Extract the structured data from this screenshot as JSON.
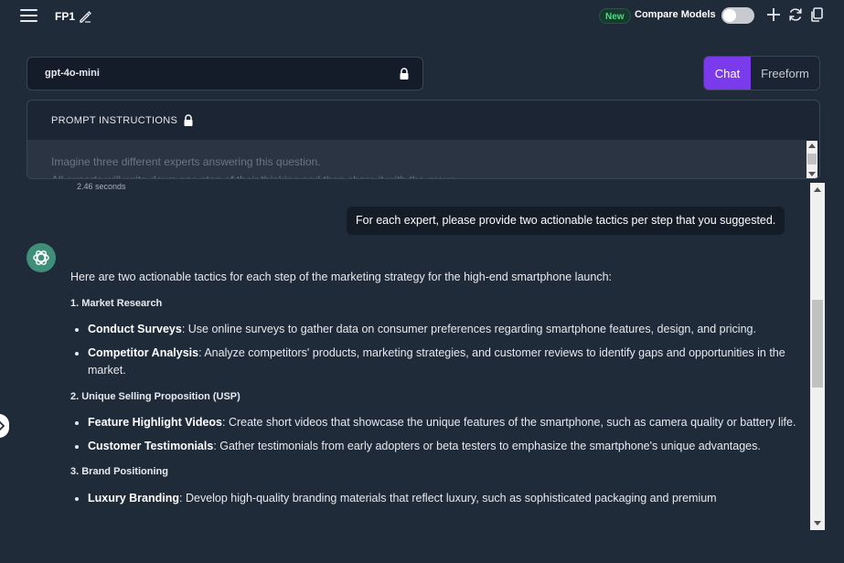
{
  "header": {
    "title": "FP1",
    "new_badge": "New",
    "compare_label": "Compare Models",
    "compare_enabled": false
  },
  "model": {
    "name": "gpt-4o-mini"
  },
  "mode": {
    "chat_label": "Chat",
    "freeform_label": "Freeform",
    "selected": "Chat"
  },
  "prompt": {
    "title": "PROMPT INSTRUCTIONS",
    "line1": "Imagine three different experts answering this question.",
    "line2": "All experts will write down one step of their thinking and then share it with the group."
  },
  "chat": {
    "timing": "2.46 seconds",
    "user_message": "For each expert, please provide two actionable tactics per step that you suggested.",
    "assistant": {
      "intro": "Here are two actionable tactics for each step of the marketing strategy for the high-end smartphone launch:",
      "sections": [
        {
          "title": "1. Market Research",
          "items": [
            {
              "bold": "Conduct Surveys",
              "text": ": Use online surveys to gather data on consumer preferences regarding smartphone features, design, and pricing."
            },
            {
              "bold": "Competitor Analysis",
              "text": ": Analyze competitors' products, marketing strategies, and customer reviews to identify gaps and opportunities in the market."
            }
          ]
        },
        {
          "title": "2. Unique Selling Proposition (USP)",
          "items": [
            {
              "bold": "Feature Highlight Videos",
              "text": ": Create short videos that showcase the unique features of the smartphone, such as camera quality or battery life."
            },
            {
              "bold": "Customer Testimonials",
              "text": ": Gather testimonials from early adopters or beta testers to emphasize the smartphone's unique advantages."
            }
          ]
        },
        {
          "title": "3. Brand Positioning",
          "items": [
            {
              "bold": "Luxury Branding",
              "text": ": Develop high-quality branding materials that reflect luxury, such as sophisticated packaging and premium"
            }
          ]
        }
      ]
    }
  },
  "colors": {
    "background": "#202b3a",
    "accent": "#7c3aed",
    "badge_green": "#4ade80"
  }
}
